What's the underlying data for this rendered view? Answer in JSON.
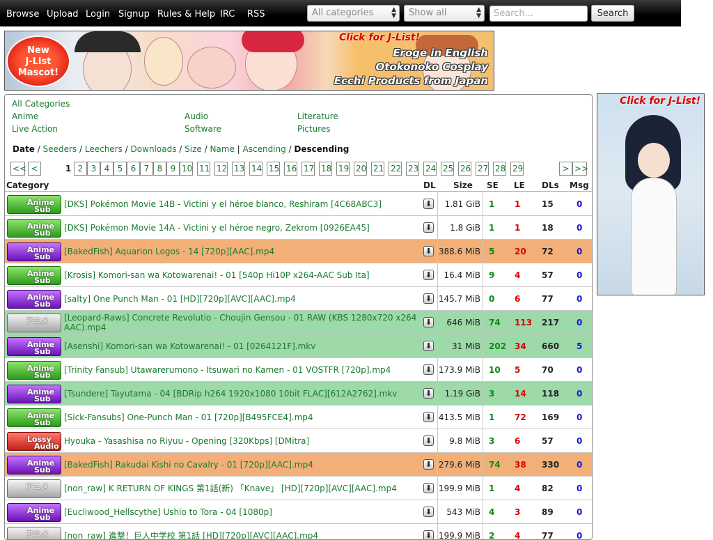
{
  "nav": [
    "Browse",
    "Upload",
    "Login",
    "Signup",
    "Rules & Help",
    "IRC",
    "RSS"
  ],
  "filters": {
    "category": "All categories",
    "show": "Show all"
  },
  "search": {
    "placeholder": "Search...",
    "button": "Search"
  },
  "banner": {
    "mascot": [
      "New",
      "J-List",
      "Mascot!"
    ],
    "click": "Click for J-List!",
    "taglines": [
      "Eroge in English",
      "Otokonoko Cosplay",
      "Ecchi Products from Japan"
    ]
  },
  "side_ad": {
    "click": "Click for J-List!"
  },
  "categories": {
    "all": "All Categories",
    "items": [
      "Anime",
      "Audio",
      "Literature",
      "Live Action",
      "Software",
      "Pictures"
    ]
  },
  "sort": {
    "date": "Date",
    "seeders": "Seeders",
    "leechers": "Leechers",
    "downloads": "Downloads",
    "size": "Size",
    "name": "Name",
    "ascending": "Ascending",
    "descending": "Descending"
  },
  "pager": {
    "first": "<<",
    "prev": "<",
    "current": "1",
    "pages": [
      "2",
      "3",
      "4",
      "5",
      "6",
      "7",
      "8",
      "9",
      "10",
      "11",
      "12",
      "13",
      "14",
      "15",
      "16",
      "17",
      "18",
      "19",
      "20",
      "21",
      "22",
      "23",
      "24",
      "25",
      "26",
      "27",
      "28",
      "29"
    ],
    "next": ">",
    "last": ">>"
  },
  "columns": {
    "category": "Category",
    "dl": "DL",
    "size": "Size",
    "se": "SE",
    "le": "LE",
    "dls": "DLs",
    "msg": "Msg"
  },
  "rows": [
    {
      "badge": "anime",
      "b1": "Anime",
      "b2": "Sub",
      "status": "",
      "name": "[DKS] Pokémon Movie 14B - Victini y el héroe blanco, Reshiram [4C68ABC3]",
      "size": "1.81 GiB",
      "se": "1",
      "le": "1",
      "dls": "15",
      "msg": "0"
    },
    {
      "badge": "anime",
      "b1": "Anime",
      "b2": "Sub",
      "status": "",
      "name": "[DKS] Pokémon Movie 14A - Victini y el héroe negro, Zekrom [0926EA45]",
      "size": "1.8 GiB",
      "se": "1",
      "le": "1",
      "dls": "18",
      "msg": "0"
    },
    {
      "badge": "purple",
      "b1": "Anime",
      "b2": "Sub",
      "status": "aplus",
      "name": "[BakedFish] Aquarion Logos - 14 [720p][AAC].mp4",
      "size": "388.6 MiB",
      "se": "5",
      "le": "20",
      "dls": "72",
      "msg": "0"
    },
    {
      "badge": "anime",
      "b1": "Anime",
      "b2": "Sub",
      "status": "",
      "name": "[Krosis] Komori-san wa Kotowarenai! - 01 [540p Hi10P x264-AAC Sub Ita]",
      "size": "16.4 MiB",
      "se": "9",
      "le": "4",
      "dls": "57",
      "msg": "0"
    },
    {
      "badge": "purple",
      "b1": "Anime",
      "b2": "Sub",
      "status": "",
      "name": "[salty] One Punch Man - 01 [HD][720p][AVC][AAC].mp4",
      "size": "145.7 MiB",
      "se": "0",
      "le": "6",
      "dls": "77",
      "msg": "0"
    },
    {
      "badge": "raw",
      "b1": "アニメ",
      "b2": "",
      "status": "trusted",
      "name": "[Leopard-Raws] Concrete Revolutio - Choujin Gensou - 01 RAW (KBS 1280x720 x264 AAC).mp4",
      "size": "646 MiB",
      "se": "74",
      "le": "113",
      "dls": "217",
      "msg": "0"
    },
    {
      "badge": "purple",
      "b1": "Anime",
      "b2": "Sub",
      "status": "trusted",
      "name": "[Asenshi] Komori-san wa Kotowarenai! - 01 [0264121F].mkv",
      "size": "31 MiB",
      "se": "202",
      "le": "34",
      "dls": "660",
      "msg": "5"
    },
    {
      "badge": "anime",
      "b1": "Anime",
      "b2": "Sub",
      "status": "",
      "name": "[Trinity Fansub] Utawarerumono - Itsuwari no Kamen - 01 VOSTFR [720p].mp4",
      "size": "173.9 MiB",
      "se": "10",
      "le": "5",
      "dls": "70",
      "msg": "0"
    },
    {
      "badge": "purple",
      "b1": "Anime",
      "b2": "Sub",
      "status": "trusted",
      "name": "[Tsundere] Tayutama - 04 [BDRip h264 1920x1080 10bit FLAC][612A2762].mkv",
      "size": "1.19 GiB",
      "se": "3",
      "le": "14",
      "dls": "118",
      "msg": "0"
    },
    {
      "badge": "anime",
      "b1": "Anime",
      "b2": "Sub",
      "status": "",
      "name": "[Sick-Fansubs] One-Punch Man - 01 [720p][B495FCE4].mp4",
      "size": "413.5 MiB",
      "se": "1",
      "le": "72",
      "dls": "169",
      "msg": "0"
    },
    {
      "badge": "lossy",
      "b1": "Lossy",
      "b2": "Audio",
      "status": "",
      "name": "Hyouka - Yasashisa no Riyuu - Opening [320Kbps] [DMitra]",
      "size": "9.8 MiB",
      "se": "3",
      "le": "6",
      "dls": "57",
      "msg": "0"
    },
    {
      "badge": "purple",
      "b1": "Anime",
      "b2": "Sub",
      "status": "aplus",
      "name": "[BakedFish] Rakudai Kishi no Cavalry - 01 [720p][AAC].mp4",
      "size": "279.6 MiB",
      "se": "74",
      "le": "38",
      "dls": "330",
      "msg": "0"
    },
    {
      "badge": "raw",
      "b1": "アニメ",
      "b2": "",
      "status": "",
      "name": "[non_raw] K RETURN OF KINGS 第1話(新) 「Knave」 [HD][720p][AVC][AAC].mp4",
      "size": "199.9 MiB",
      "se": "1",
      "le": "4",
      "dls": "82",
      "msg": "0"
    },
    {
      "badge": "purple",
      "b1": "Anime",
      "b2": "Sub",
      "status": "",
      "name": "[Eucliwood_Hellscythe] Ushio to Tora - 04 [1080p]",
      "size": "543 MiB",
      "se": "4",
      "le": "3",
      "dls": "89",
      "msg": "0"
    },
    {
      "badge": "raw",
      "b1": "アニメ",
      "b2": "",
      "status": "",
      "name": "[non_raw] 進撃！巨人中学校 第1話 [HD][720p][AVC][AAC].mp4",
      "size": "199.9 MiB",
      "se": "2",
      "le": "4",
      "dls": "77",
      "msg": "0"
    }
  ]
}
